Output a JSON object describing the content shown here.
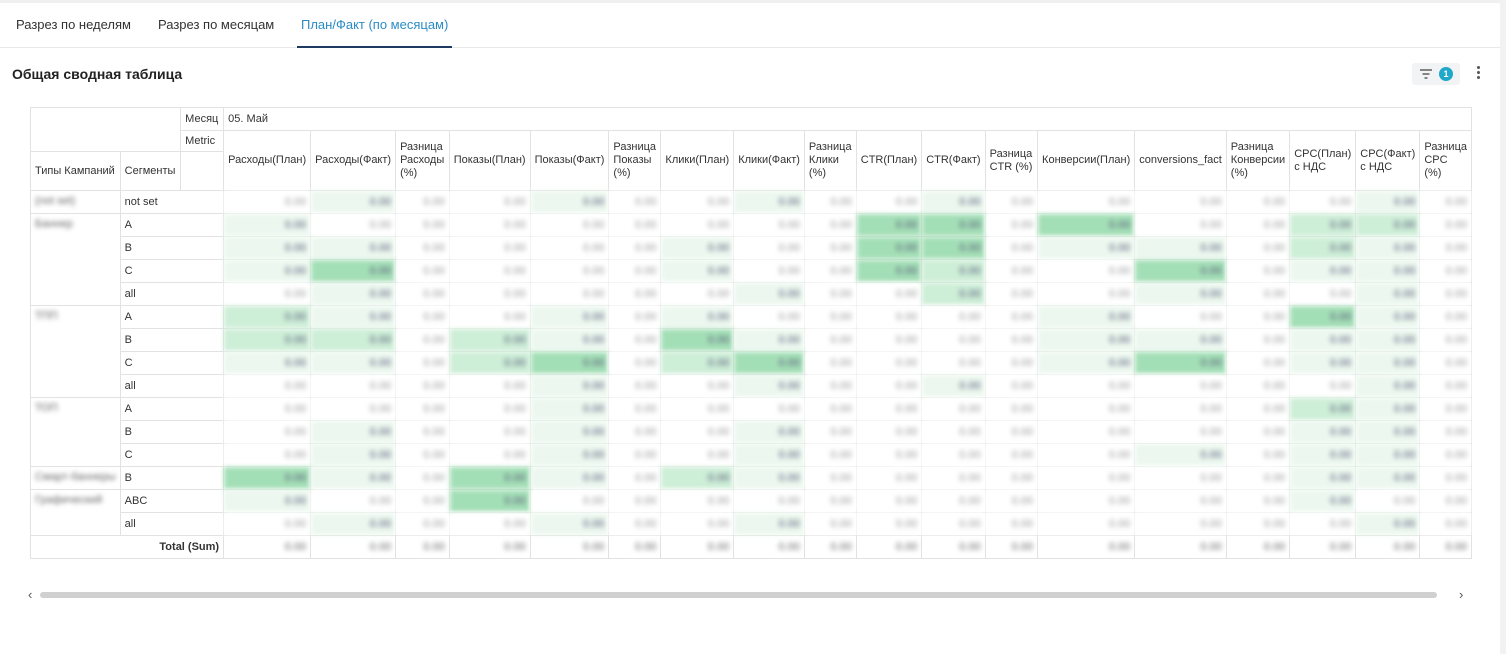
{
  "tabs": [
    {
      "label": "Разрез по неделям",
      "active": false
    },
    {
      "label": "Разрез по месяцам",
      "active": false
    },
    {
      "label": "План/Факт (по месяцам)",
      "active": true
    }
  ],
  "panel": {
    "title": "Общая сводная таблица",
    "filter_count": "1"
  },
  "pivot": {
    "month_label": "Месяц",
    "month_value": "05. Май",
    "metric_label": "Metric",
    "row_header_1": "Типы Кампаний",
    "row_header_2": "Сегменты",
    "total_label": "Total (Sum)",
    "columns": [
      "Расходы(План)",
      "Расходы(Факт)",
      "Разница Расходы (%)",
      "Показы(План)",
      "Показы(Факт)",
      "Разница Показы (%)",
      "Клики(План)",
      "Клики(Факт)",
      "Разница Клики (%)",
      "CTR(План)",
      "CTR(Факт)",
      "Разница CTR (%)",
      "Конверсии(План)",
      "conversions_fact",
      "Разница Конверсии (%)",
      "CPC(План) с НДС",
      "CPC(Факт) с НДС",
      "Разница CPC (%)"
    ],
    "rows": [
      {
        "type": "(not set)",
        "segment": "not set"
      },
      {
        "type": "Баннер",
        "segment": "A"
      },
      {
        "type": "",
        "segment": "B"
      },
      {
        "type": "",
        "segment": "C"
      },
      {
        "type": "",
        "segment": "all"
      },
      {
        "type": "ТПП",
        "segment": "A"
      },
      {
        "type": "",
        "segment": "B"
      },
      {
        "type": "",
        "segment": "C"
      },
      {
        "type": "",
        "segment": "all"
      },
      {
        "type": "ТОП",
        "segment": "A"
      },
      {
        "type": "",
        "segment": "B"
      },
      {
        "type": "",
        "segment": "C"
      },
      {
        "type": "Смарт-баннеры",
        "segment": "B"
      },
      {
        "type": "Графический",
        "segment": "ABC"
      },
      {
        "type": "",
        "segment": "all"
      }
    ]
  },
  "colors": {
    "accent": "#2b8cc4",
    "tab_underline": "#1f3a60",
    "badge": "#20a7c9",
    "heat_base": "#8fd6a6"
  }
}
